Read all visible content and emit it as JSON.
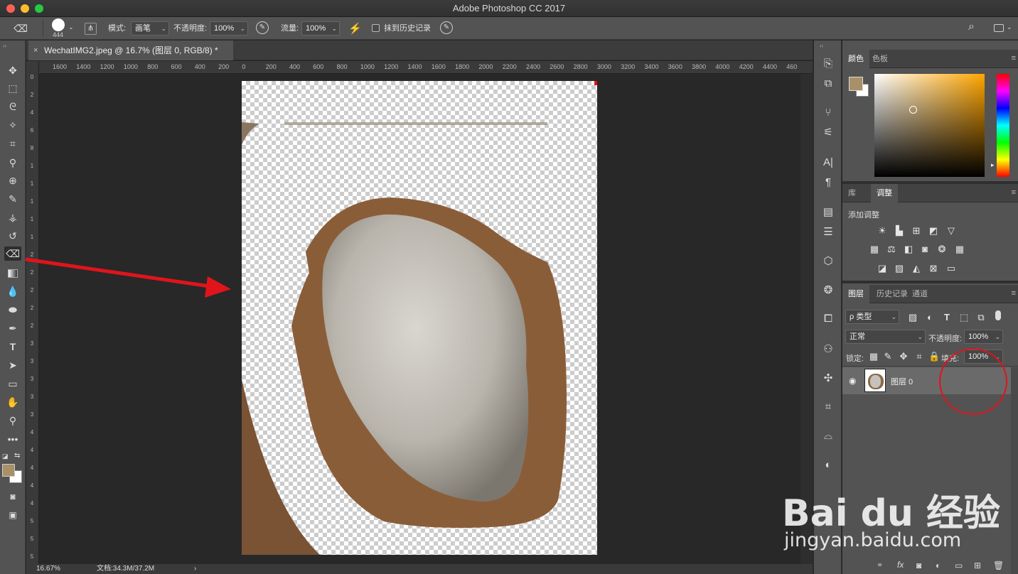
{
  "window": {
    "title": "Adobe Photoshop CC 2017"
  },
  "options": {
    "brush_size": "444",
    "mode_label": "模式:",
    "mode_value": "画笔",
    "opacity_label": "不透明度:",
    "opacity_value": "100%",
    "flow_label": "流量:",
    "flow_value": "100%",
    "history_label": "抹到历史记录"
  },
  "document": {
    "tab_title": "WechatIMG2.jpeg @ 16.7% (图层 0, RGB/8) *",
    "ruler_h": [
      "1600",
      "1400",
      "1200",
      "1000",
      "800",
      "600",
      "400",
      "200",
      "0",
      "200",
      "400",
      "600",
      "800",
      "1000",
      "1200",
      "1400",
      "1600",
      "1800",
      "2000",
      "2200",
      "2400",
      "2600",
      "2800",
      "3000",
      "3200",
      "3400",
      "3600",
      "3800",
      "4000",
      "4200",
      "4400",
      "460"
    ],
    "ruler_v": [
      "0",
      "2",
      "4",
      "6",
      "8",
      "1",
      "1",
      "1",
      "1",
      "1",
      "2",
      "2",
      "2",
      "2",
      "2",
      "3",
      "3",
      "3",
      "3",
      "3",
      "4",
      "4",
      "4",
      "4",
      "4",
      "5",
      "5",
      "5"
    ]
  },
  "status": {
    "zoom": "16.67%",
    "doc_size": "文档:34.3M/37.2M"
  },
  "colors": {
    "foreground": "#a89068",
    "background": "#ffffff",
    "panel": "#535353",
    "accent_red": "#e0141b"
  },
  "color_panel": {
    "tabs": [
      "颜色",
      "色板"
    ]
  },
  "adjust_panel": {
    "tabs": [
      "库",
      "调整"
    ],
    "title": "添加调整"
  },
  "layers_panel": {
    "tabs": [
      "图层",
      "历史记录",
      "通道"
    ],
    "filter_label": "ρ 类型",
    "blend_mode": "正常",
    "opacity_label": "不透明度:",
    "opacity_value": "100%",
    "lock_label": "锁定:",
    "fill_label": "填充:",
    "fill_value": "100%",
    "layers": [
      {
        "name": "图层 0",
        "visible": true
      }
    ]
  },
  "watermark": {
    "brand": "Bai du 经验",
    "url": "jingyan.baidu.com"
  }
}
